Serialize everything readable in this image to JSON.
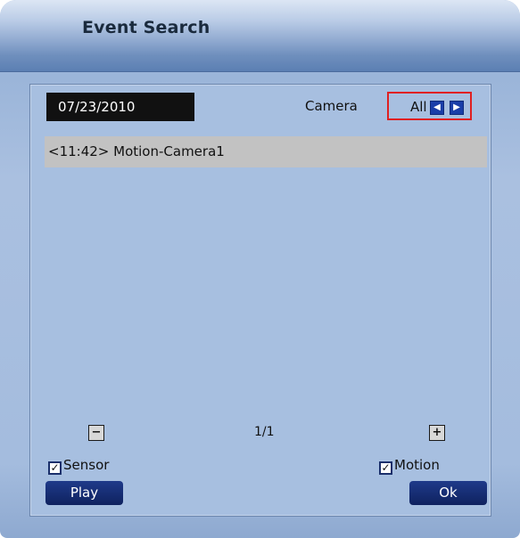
{
  "window": {
    "title": "Event Search"
  },
  "filter": {
    "date": "07/23/2010",
    "camera_label": "Camera",
    "camera_value": "All",
    "prev_icon": "arrow-left-icon",
    "next_icon": "arrow-right-icon"
  },
  "events": [
    {
      "label": "<11:42> Motion-Camera1"
    }
  ],
  "pagination": {
    "indicator": "1/1",
    "prev_label": "−",
    "next_label": "+"
  },
  "filters": {
    "sensor": {
      "label": "Sensor",
      "checked": true
    },
    "motion": {
      "label": "Motion",
      "checked": true
    }
  },
  "buttons": {
    "play": "Play",
    "ok": "Ok"
  },
  "colors": {
    "accent": "#1a3ea8",
    "highlight_border": "#e02020",
    "button_bg": "#0f225f",
    "row_bg": "#c2c2c2"
  }
}
